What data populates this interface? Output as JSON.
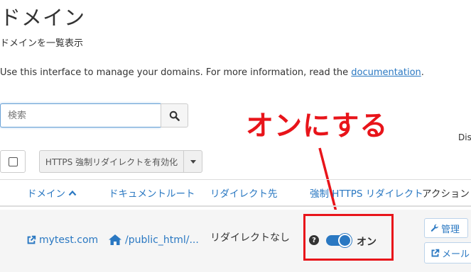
{
  "page": {
    "title": "ドメイン",
    "subtitle": "ドメインを一覧表示",
    "description_prefix": "Use this interface to manage your domains. For more information, read the ",
    "description_link": "documentation",
    "description_suffix": "."
  },
  "search": {
    "placeholder": "検索",
    "value": ""
  },
  "annotation": {
    "text": "オンにする",
    "color": "#e8141a"
  },
  "display_label": "Dis",
  "toolbar": {
    "bulk_https_label": "HTTPS 強制リダイレクトを有効化"
  },
  "table": {
    "headers": {
      "domain": "ドメイン",
      "document_root": "ドキュメントルート",
      "redirect_to": "リダイレクト先",
      "force_https": "強制 HTTPS リダイレクト",
      "actions": "アクション"
    },
    "rows": [
      {
        "domain": "mytest.com",
        "document_root": "/public_html/...",
        "redirect": "リダイレクトなし",
        "force_https_state": "オン",
        "force_https_on": true,
        "actions": {
          "manage": "管理",
          "email": "メール"
        }
      }
    ]
  },
  "colors": {
    "link": "#2a78c2",
    "accent_red": "#e8141a",
    "toggle_on": "#2a78c2"
  }
}
